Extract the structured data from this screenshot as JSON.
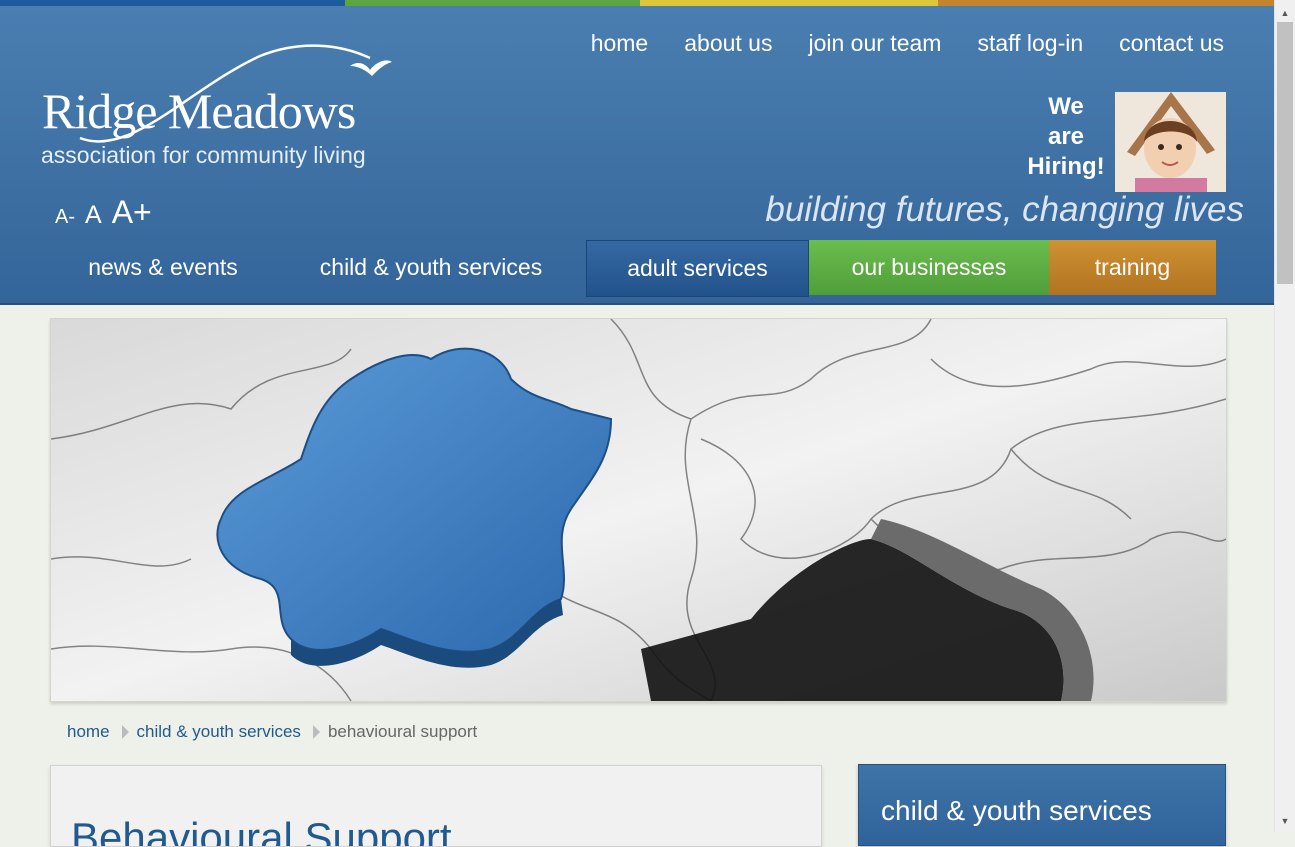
{
  "brand": {
    "name": "Ridge Meadows",
    "subtitle": "association for community living"
  },
  "colors": {
    "strip": [
      "#1e5b9c",
      "#5ba63f",
      "#e0c73a",
      "#c2852d"
    ],
    "header": "#3d6fa3",
    "nav_adult": "#27578f",
    "nav_businesses": "#5aab45",
    "nav_training": "#c0822a",
    "link": "#215a8e"
  },
  "font_controls": [
    "A-",
    "A",
    "A+"
  ],
  "top_nav": [
    "home",
    "about us",
    "join our team",
    "staff log-in",
    "contact us"
  ],
  "hiring": {
    "line1": "We",
    "line2": "are",
    "line3": "Hiring!"
  },
  "tagline": "building futures, changing lives",
  "main_nav": [
    "news & events",
    "child & youth services",
    "adult services",
    "our businesses",
    "training"
  ],
  "breadcrumb": [
    "home",
    "child & youth services",
    "behavioural support"
  ],
  "content": {
    "title": "Behavioural Support"
  },
  "sidebar": {
    "title": "child & youth services"
  },
  "icons": {
    "scroll_up": "triangle-up-icon",
    "scroll_down": "triangle-down-icon",
    "breadcrumb_sep": "chevron-right-icon"
  }
}
